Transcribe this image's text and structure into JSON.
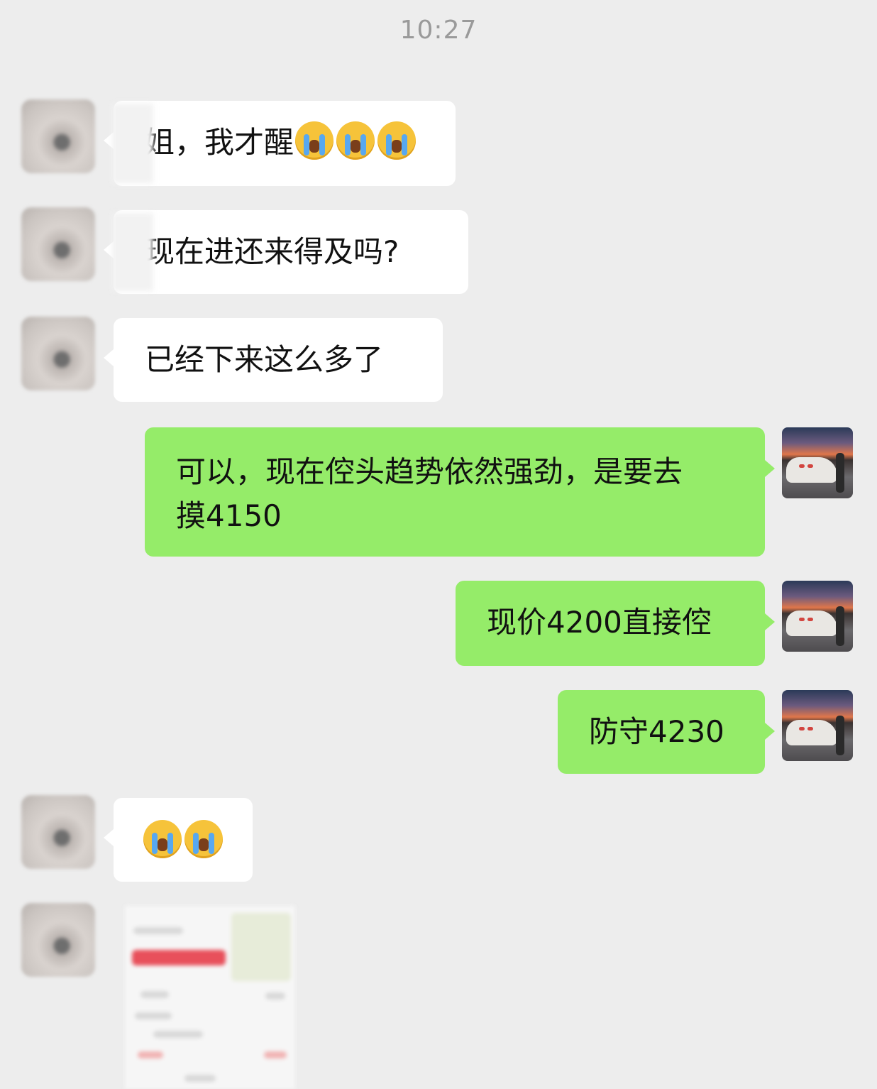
{
  "timestamp": "10:27",
  "messages": [
    {
      "sender": "other",
      "text": "姐，我才醒",
      "emoji_count": 3,
      "emoji_name": "loudly-crying-face"
    },
    {
      "sender": "other",
      "text": "现在进还来得及吗?"
    },
    {
      "sender": "other",
      "text": "已经下来这么多了"
    },
    {
      "sender": "me",
      "line1": "可以，现在倥头趋势依然强劲，是要去",
      "line2": "摸4150"
    },
    {
      "sender": "me",
      "text": "现价4200直接倥"
    },
    {
      "sender": "me",
      "text": "防守4230"
    },
    {
      "sender": "other",
      "emoji_count": 2,
      "emoji_name": "loudly-crying-face"
    },
    {
      "sender": "other",
      "type": "image",
      "description": "blurred-screenshot"
    }
  ],
  "colors": {
    "background": "#ededed",
    "incoming_bubble": "#ffffff",
    "outgoing_bubble": "#95ec69",
    "timestamp_text": "#9a9a9a"
  }
}
